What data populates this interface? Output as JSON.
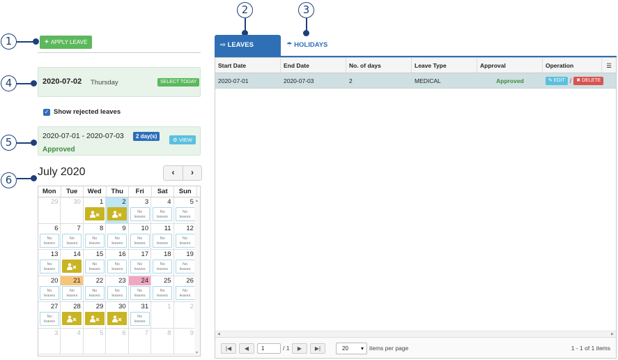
{
  "callouts": [
    "1",
    "2",
    "3",
    "4",
    "5",
    "6"
  ],
  "apply_leave": {
    "label": "APPLY LEAVE"
  },
  "selected_date": {
    "date": "2020-07-02",
    "weekday": "Thursday",
    "select_today_label": "SELECT TODAY"
  },
  "show_rejected": {
    "label": "Show rejected leaves",
    "checked": true
  },
  "leave_summary": {
    "range": "2020-07-01 - 2020-07-03",
    "days_badge": "2 day(s)",
    "view_label": "VIEW",
    "status": "Approved"
  },
  "calendar": {
    "title": "July 2020",
    "prev": "‹",
    "next": "›",
    "weekdays": [
      "Mon",
      "Tue",
      "Wed",
      "Thu",
      "Fri",
      "Sat",
      "Sun"
    ],
    "no_leaves_text": "No leaves",
    "weeks": [
      [
        {
          "n": "29",
          "other": true
        },
        {
          "n": "30",
          "other": true
        },
        {
          "n": "1",
          "leave": true
        },
        {
          "n": "2",
          "leave": true,
          "today": true
        },
        {
          "n": "3",
          "noleave": true
        },
        {
          "n": "4",
          "noleave": true
        },
        {
          "n": "5",
          "noleave": true
        }
      ],
      [
        {
          "n": "6",
          "noleave": true
        },
        {
          "n": "7",
          "noleave": true
        },
        {
          "n": "8",
          "noleave": true
        },
        {
          "n": "9",
          "noleave": true
        },
        {
          "n": "10",
          "noleave": true
        },
        {
          "n": "11",
          "noleave": true
        },
        {
          "n": "12",
          "noleave": true
        }
      ],
      [
        {
          "n": "13",
          "noleave": true
        },
        {
          "n": "14",
          "leave": true
        },
        {
          "n": "15",
          "noleave": true
        },
        {
          "n": "16",
          "noleave": true
        },
        {
          "n": "17",
          "noleave": true
        },
        {
          "n": "18",
          "noleave": true
        },
        {
          "n": "19",
          "noleave": true
        }
      ],
      [
        {
          "n": "20",
          "noleave": true
        },
        {
          "n": "21",
          "noleave": true,
          "hl": "orange"
        },
        {
          "n": "22",
          "noleave": true
        },
        {
          "n": "23",
          "noleave": true
        },
        {
          "n": "24",
          "noleave": true,
          "hl": "pink"
        },
        {
          "n": "25",
          "noleave": true
        },
        {
          "n": "26",
          "noleave": true
        }
      ],
      [
        {
          "n": "27",
          "noleave": true
        },
        {
          "n": "28",
          "leave": true
        },
        {
          "n": "29",
          "leave": true
        },
        {
          "n": "30",
          "leave": true
        },
        {
          "n": "31",
          "noleave": true
        },
        {
          "n": "1",
          "other": true
        },
        {
          "n": "2",
          "other": true
        }
      ],
      [
        {
          "n": "3",
          "other": true
        },
        {
          "n": "4",
          "other": true
        },
        {
          "n": "5",
          "other": true
        },
        {
          "n": "6",
          "other": true
        },
        {
          "n": "7",
          "other": true
        },
        {
          "n": "8",
          "other": true
        },
        {
          "n": "9",
          "other": true
        }
      ]
    ]
  },
  "tabs": {
    "leaves": "LEAVES",
    "holidays": "HOLIDAYS"
  },
  "grid": {
    "columns": [
      "Start Date",
      "End Date",
      "No. of days",
      "Leave Type",
      "Approval",
      "Operation"
    ],
    "rows": [
      {
        "start": "2020-07-01",
        "end": "2020-07-03",
        "days": "2",
        "type": "MEDICAL",
        "approval": "Approved",
        "edit": "EDIT",
        "sep": "/",
        "delete": "DELETE"
      }
    ],
    "menu_icon": "☰"
  },
  "pager": {
    "first": "|◀",
    "prev": "◀",
    "page": "1",
    "of": "/ 1",
    "next": "▶",
    "last": "▶|",
    "page_size": "20",
    "page_size_caret": "▾",
    "items_per_page": "items per page",
    "summary": "1 - 1 of 1 items"
  },
  "colors": {
    "accent": "#2f6fb6",
    "green": "#5cb85c",
    "leave_yellow": "#c9b424",
    "today": "#bfe6f5",
    "callout": "#1d3f7a"
  }
}
